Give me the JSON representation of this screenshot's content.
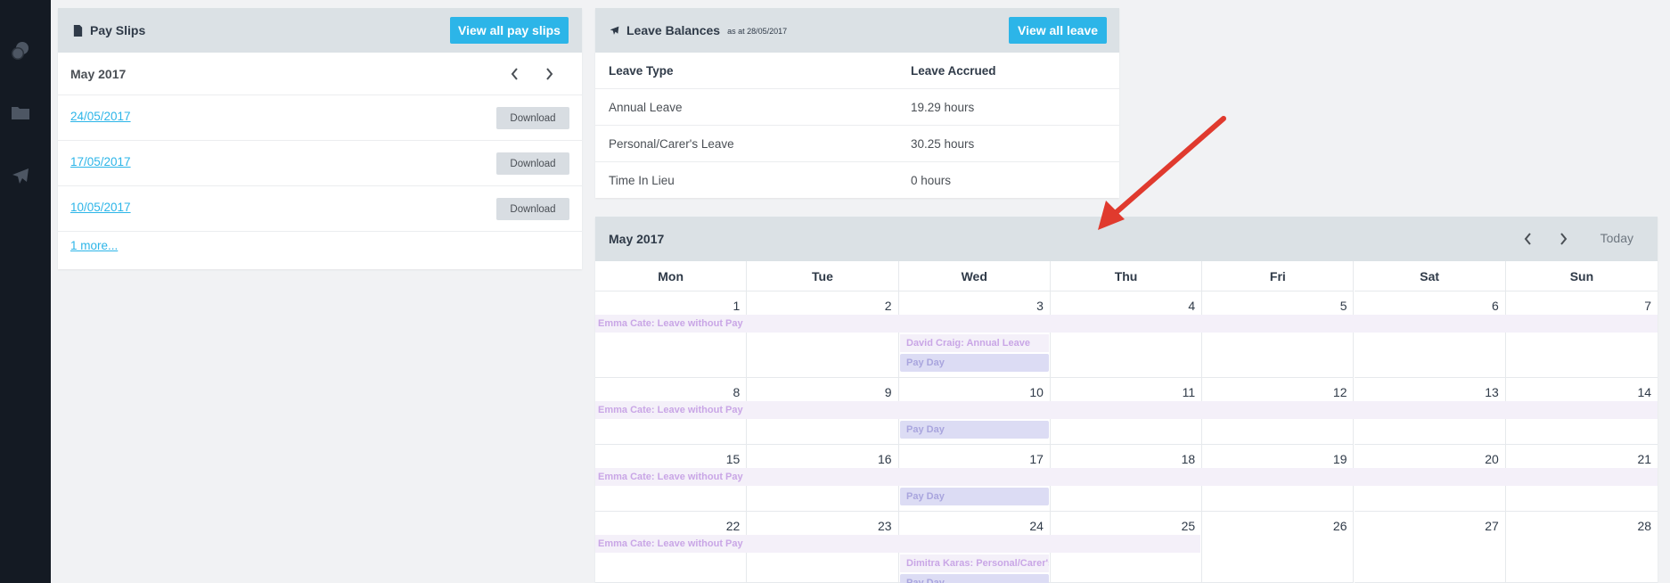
{
  "sidebar": {
    "icons": [
      "coins-icon",
      "folder-icon",
      "plane-icon"
    ]
  },
  "payslips": {
    "title": "Pay Slips",
    "view_all_label": "View all pay slips",
    "month": "May 2017",
    "slips": [
      {
        "date": "24/05/2017",
        "action": "Download"
      },
      {
        "date": "17/05/2017",
        "action": "Download"
      },
      {
        "date": "10/05/2017",
        "action": "Download"
      }
    ],
    "more_label": "1 more..."
  },
  "leave": {
    "title": "Leave Balances",
    "as_at": "as at 28/05/2017",
    "view_all_label": "View all leave",
    "columns": [
      "Leave Type",
      "Leave Accrued"
    ],
    "rows": [
      {
        "type": "Annual Leave",
        "accrued": "19.29 hours"
      },
      {
        "type": "Personal/Carer's Leave",
        "accrued": "30.25 hours"
      },
      {
        "type": "Time In Lieu",
        "accrued": "0 hours"
      }
    ]
  },
  "calendar": {
    "title": "May 2017",
    "today_label": "Today",
    "weekdays": [
      "Mon",
      "Tue",
      "Wed",
      "Thu",
      "Fri",
      "Sat",
      "Sun"
    ],
    "weeks": [
      [
        "1",
        "2",
        "3",
        "4",
        "5",
        "6",
        "7"
      ],
      [
        "8",
        "9",
        "10",
        "11",
        "12",
        "13",
        "14"
      ],
      [
        "15",
        "16",
        "17",
        "18",
        "19",
        "20",
        "21"
      ],
      [
        "22",
        "23",
        "24",
        "25",
        "26",
        "27",
        "28"
      ]
    ],
    "events": {
      "lwop": "Emma Cate: Leave without Pay",
      "annual": "David Craig: Annual Leave",
      "pay_day": "Pay Day",
      "personal": "Dimitra Karas: Personal/Carer's Leave"
    }
  }
}
